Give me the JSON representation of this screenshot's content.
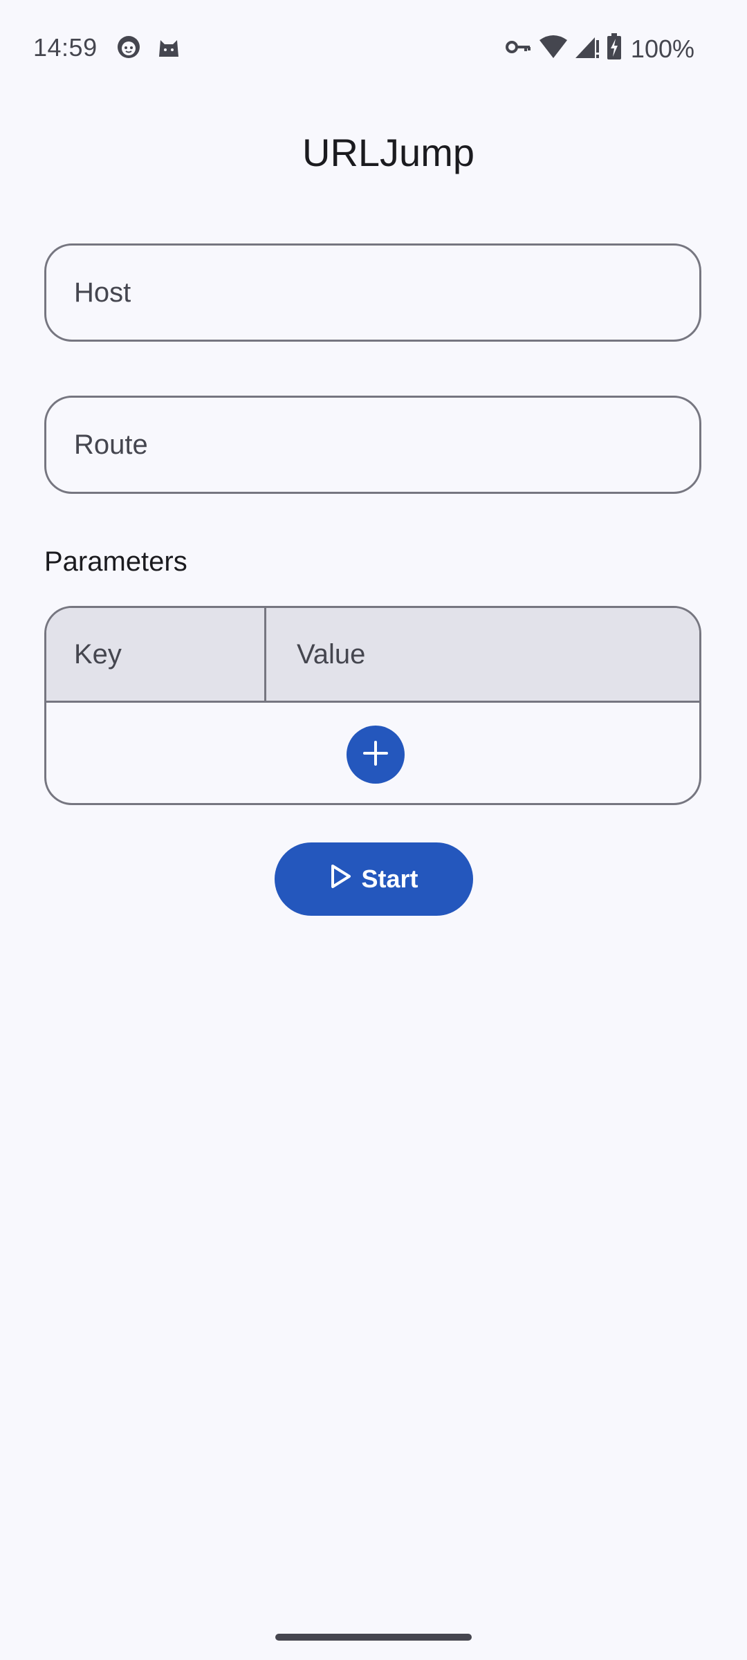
{
  "status_bar": {
    "time": "14:59",
    "battery": "100%",
    "left_icons": [
      "face-notification-icon",
      "cat-notification-icon"
    ],
    "right_icons": [
      "vpn-key-icon",
      "wifi-icon",
      "signal-icon",
      "battery-charging-icon"
    ]
  },
  "app": {
    "title": "URLJump"
  },
  "form": {
    "host_placeholder": "Host",
    "route_placeholder": "Route",
    "parameters_label": "Parameters",
    "key_header": "Key",
    "value_header": "Value",
    "add_icon": "plus-icon",
    "start_label": "Start",
    "start_icon": "play-outline-icon"
  },
  "colors": {
    "background": "#f8f8fd",
    "primary": "#2457bd",
    "outline": "#767680",
    "table_header": "#e2e2ea",
    "text_secondary": "#45464f"
  }
}
